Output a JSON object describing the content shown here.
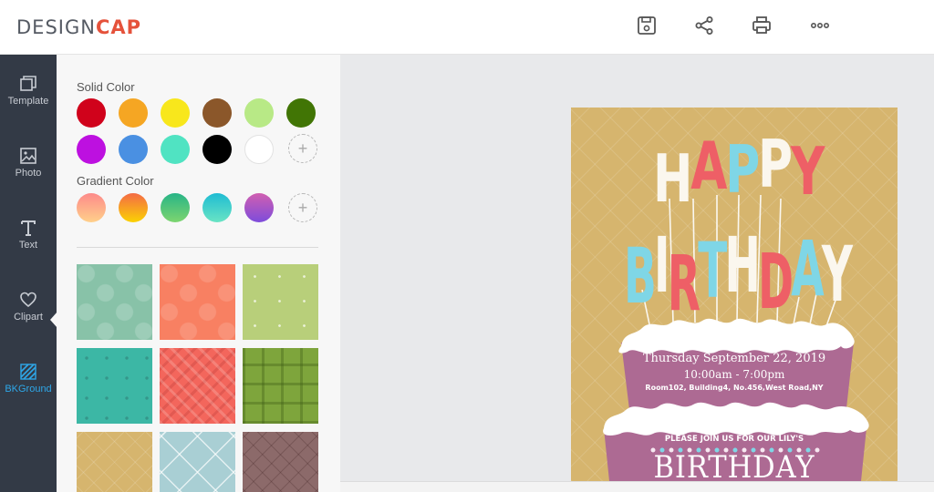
{
  "brand": {
    "part1": "DESIGN",
    "part2": "CAP"
  },
  "toolbar": {
    "icons": [
      "save-icon",
      "share-icon",
      "print-icon",
      "more-icon"
    ]
  },
  "nav": {
    "items": [
      {
        "label": "Template",
        "icon": "template-icon"
      },
      {
        "label": "Photo",
        "icon": "photo-icon"
      },
      {
        "label": "Text",
        "icon": "text-icon"
      },
      {
        "label": "Clipart",
        "icon": "heart-icon"
      },
      {
        "label": "BKGround",
        "icon": "background-icon",
        "active": true
      }
    ]
  },
  "panel": {
    "solid_title": "Solid Color",
    "solid_colors": [
      "#d0021b",
      "#f5a623",
      "#f8e71c",
      "#8b572a",
      "#b8e986",
      "#417505",
      "#bd10e0",
      "#4a90e2",
      "#50e3c2",
      "#000000",
      "#ffffff"
    ],
    "gradient_title": "Gradient Color",
    "gradient_colors": [
      [
        "#fd8a8a",
        "#ffd08a"
      ],
      [
        "#f46b45",
        "#fbd203"
      ],
      [
        "#28b487",
        "#7dd56f"
      ],
      [
        "#1fbcd3",
        "#69e4c4"
      ],
      [
        "#d15fb0",
        "#7d4cdb"
      ]
    ],
    "add_label": "+"
  },
  "card": {
    "happy": "HAPPY",
    "birthday": "BIRTHDAY",
    "date": "Thursday  September 22, 2019",
    "time": "10:00am - 7:00pm",
    "address": "Room102, Building4, No.456,West Road,NY",
    "invite": "PLEASE JOIN US FOR  OUR LILY'S",
    "birthday_bottom": "BIRTHDAY"
  }
}
